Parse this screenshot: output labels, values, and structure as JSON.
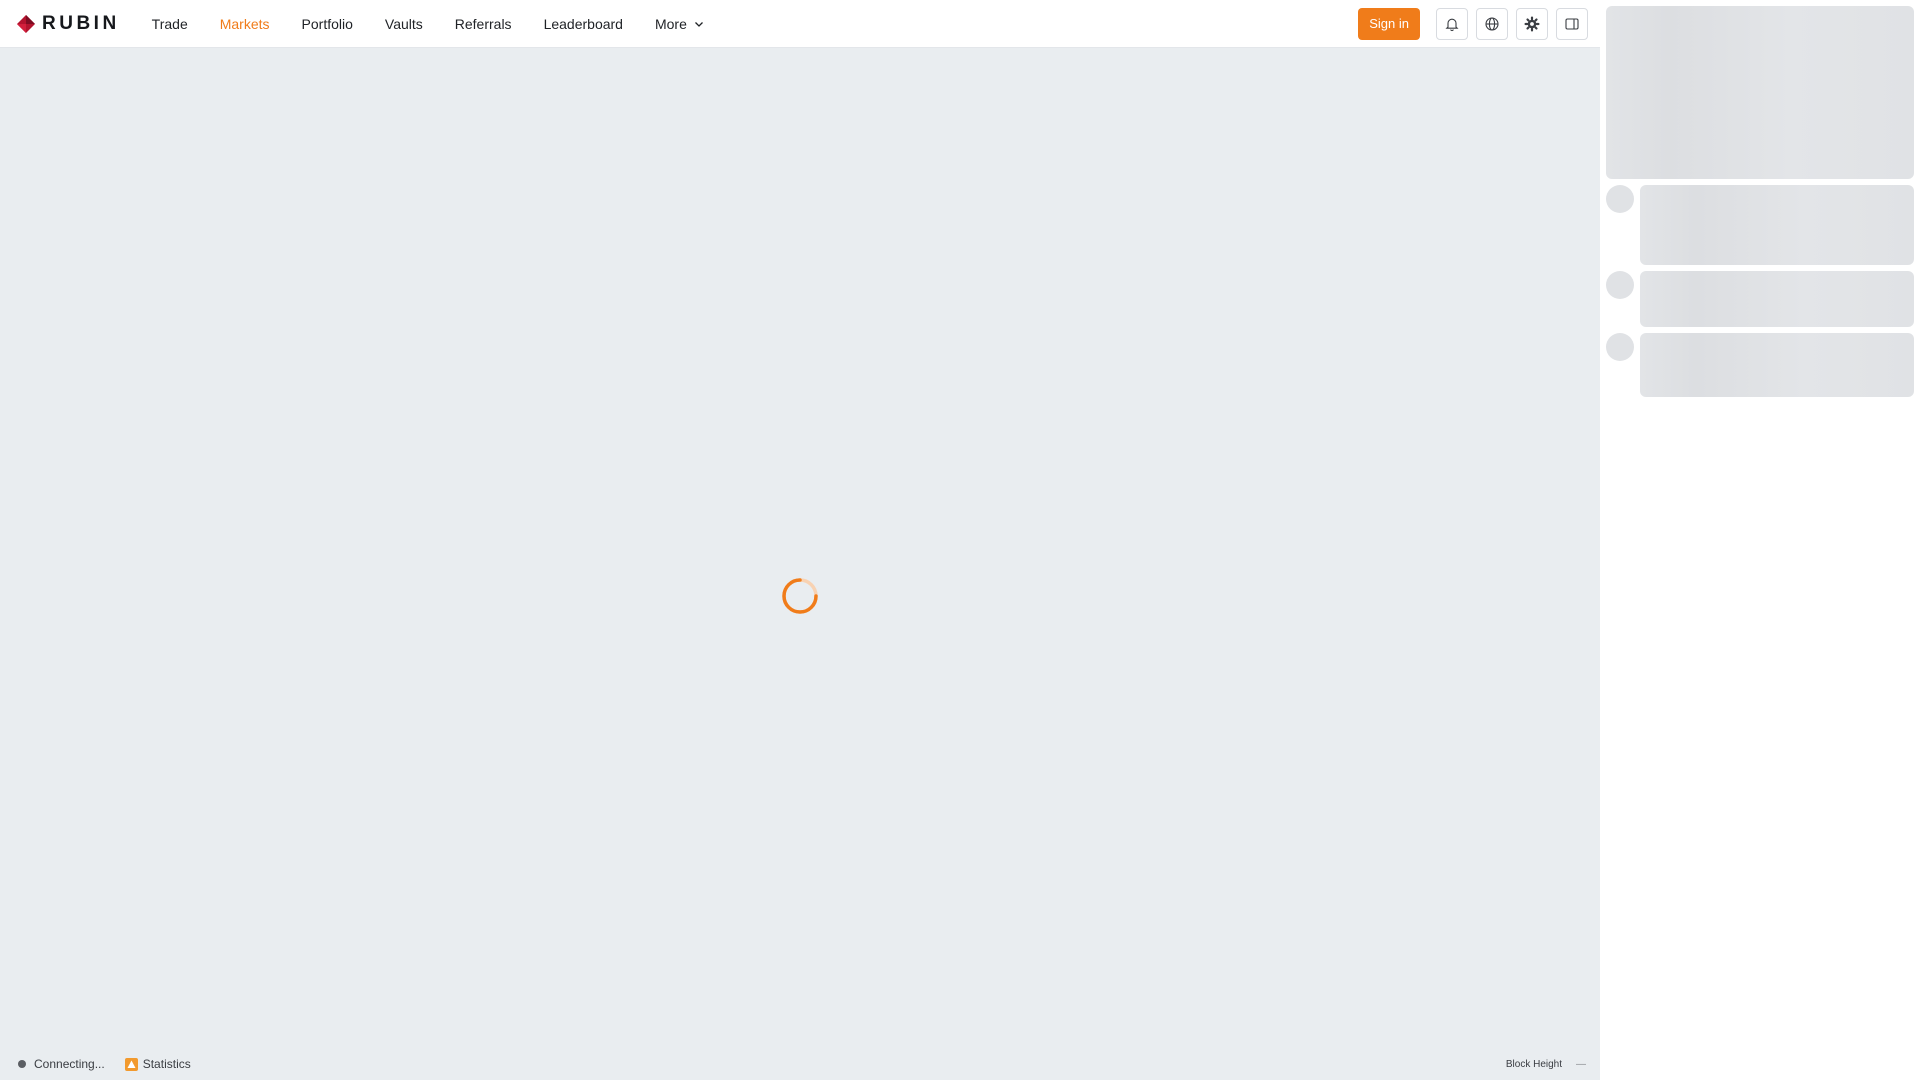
{
  "app": {
    "brand": "RUBIN"
  },
  "nav": {
    "items": [
      {
        "label": "Trade"
      },
      {
        "label": "Markets"
      },
      {
        "label": "Portfolio"
      },
      {
        "label": "Vaults"
      },
      {
        "label": "Referrals"
      },
      {
        "label": "Leaderboard"
      },
      {
        "label": "More"
      }
    ],
    "active": "Markets"
  },
  "header": {
    "sign_in_label": "Sign in",
    "icons": [
      "bell-icon",
      "globe-icon",
      "gear-icon",
      "sidebar-toggle-icon"
    ]
  },
  "main": {
    "state": "loading",
    "spinner_icon": "spinner-icon"
  },
  "footer": {
    "status_label": "Connecting...",
    "statistics_label": "Statistics",
    "block_height_label": "Block Height",
    "block_height_value": "—"
  },
  "colors": {
    "accent": "#f07c1a",
    "brand_mark": "#b3132e",
    "background": "#e9edf0",
    "header_bg": "#ffffff"
  }
}
